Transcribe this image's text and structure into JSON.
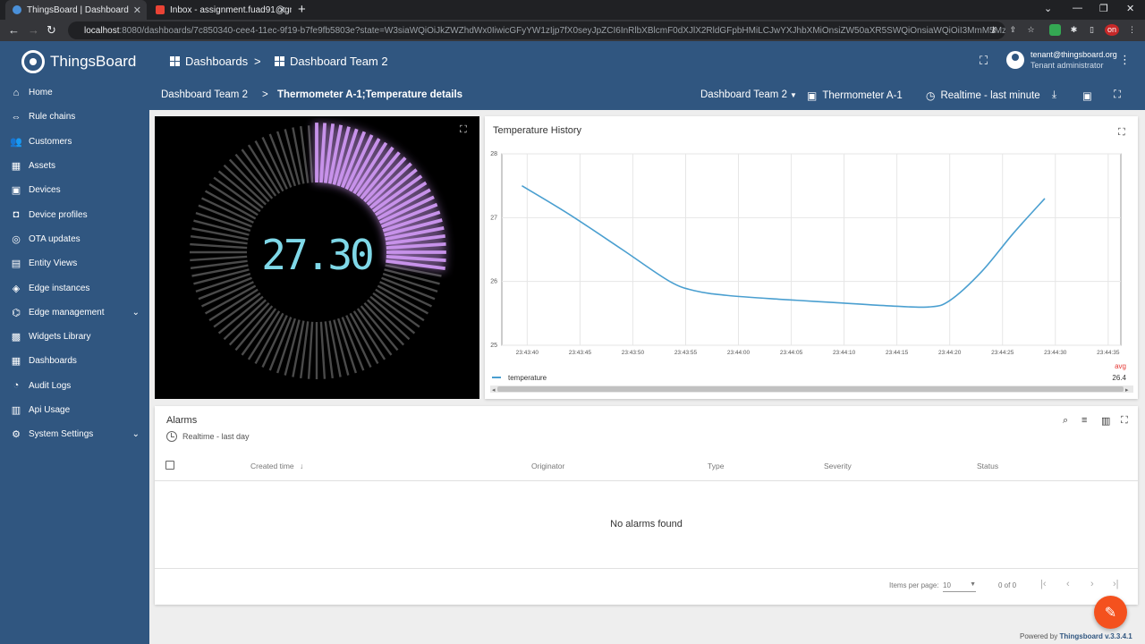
{
  "browser": {
    "tabs": [
      {
        "title": "ThingsBoard | Dashboard",
        "active": true
      },
      {
        "title": "Inbox - assignment.fuad91@gma...",
        "active": false
      }
    ],
    "url_host": "localhost",
    "url_rest": ":8080/dashboards/7c850340-cee4-11ec-9f19-b7fe9fb5803e?state=W3siaWQiOiJkZWZhdWx0IiwicGFyYW1zIjp7fX0seyJpZCI6InRlbXBlcmF0dXJlX2RldGFpbHMiLCJwYXJhbXMiOnsiZW50aXR5SWQiOnsiaWQiOiI3MmM5MzVlMC1lZWUz...",
    "ext_badge": "on"
  },
  "app": {
    "logo": "ThingsBoard",
    "breadcrumb": {
      "parent": "Dashboards",
      "sep": ">",
      "current": "Dashboard Team 2"
    },
    "user": {
      "email": "tenant@thingsboard.org",
      "role": "Tenant administrator"
    }
  },
  "sidebar": {
    "items": [
      {
        "label": "Home",
        "icon": "home-icon",
        "glyph": "⌂",
        "expandable": false
      },
      {
        "label": "Rule chains",
        "icon": "rule-chains-icon",
        "glyph": "⇔",
        "expandable": false
      },
      {
        "label": "Customers",
        "icon": "customers-icon",
        "glyph": "👥",
        "expandable": false
      },
      {
        "label": "Assets",
        "icon": "assets-icon",
        "glyph": "▦",
        "expandable": false
      },
      {
        "label": "Devices",
        "icon": "devices-icon",
        "glyph": "▣",
        "expandable": false
      },
      {
        "label": "Device profiles",
        "icon": "device-profiles-icon",
        "glyph": "◘",
        "expandable": false
      },
      {
        "label": "OTA updates",
        "icon": "ota-updates-icon",
        "glyph": "◎",
        "expandable": false
      },
      {
        "label": "Entity Views",
        "icon": "entity-views-icon",
        "glyph": "▤",
        "expandable": false
      },
      {
        "label": "Edge instances",
        "icon": "edge-instances-icon",
        "glyph": "◈",
        "expandable": false
      },
      {
        "label": "Edge management",
        "icon": "edge-management-icon",
        "glyph": "⌬",
        "expandable": true
      },
      {
        "label": "Widgets Library",
        "icon": "widgets-library-icon",
        "glyph": "▩",
        "expandable": false
      },
      {
        "label": "Dashboards",
        "icon": "dashboards-icon",
        "glyph": "▦",
        "expandable": false
      },
      {
        "label": "Audit Logs",
        "icon": "audit-logs-icon",
        "glyph": "◔",
        "expandable": false
      },
      {
        "label": "Api Usage",
        "icon": "api-usage-icon",
        "glyph": "▥",
        "expandable": false
      },
      {
        "label": "System Settings",
        "icon": "system-settings-icon",
        "glyph": "⚙",
        "expandable": true
      }
    ]
  },
  "dashboard": {
    "crumb_root": "Dashboard Team 2",
    "crumb_sep": ">",
    "crumb_state": "Thermometer A-1;Temperature details",
    "state_select": "Dashboard Team 2",
    "entity": "Thermometer A-1",
    "timewindow": "Realtime - last minute"
  },
  "gauge": {
    "value": 27.3,
    "display": "27.30",
    "min": 0,
    "max": 100,
    "colors": {
      "active": "#c792ea",
      "inactive": "#4a4a4a",
      "text": "#7fd8e8"
    }
  },
  "temperature_chart": {
    "title": "Temperature History",
    "legend_label": "temperature",
    "legend_stat_label": "avg",
    "legend_stat_value": "26.4",
    "color": "#4a9fd0"
  },
  "chart_data": {
    "type": "line",
    "title": "Temperature History",
    "ylim": [
      25,
      28
    ],
    "y_ticks": [
      25,
      26,
      27,
      28
    ],
    "x_ticks": [
      "23:43:40",
      "23:43:45",
      "23:43:50",
      "23:43:55",
      "23:44:00",
      "23:44:05",
      "23:44:10",
      "23:44:15",
      "23:44:20",
      "23:44:25",
      "23:44:30",
      "23:44:35"
    ],
    "x_range_seconds": [
      37.6,
      96.2
    ],
    "series": [
      {
        "name": "temperature",
        "x": [
          39.5,
          44,
          49,
          53.5,
          56,
          59,
          64,
          69,
          74,
          78,
          80,
          83,
          86,
          89
        ],
        "y": [
          27.5,
          27.05,
          26.5,
          26.0,
          25.85,
          25.78,
          25.72,
          25.67,
          25.62,
          25.6,
          25.7,
          26.15,
          26.75,
          27.3
        ]
      }
    ],
    "legend": "bottom-left",
    "grid": true
  },
  "alarms": {
    "title": "Alarms",
    "timewindow": "Realtime - last day",
    "columns": [
      "Created time",
      "Originator",
      "Type",
      "Severity",
      "Status"
    ],
    "empty_text": "No alarms found",
    "items_per_page_label": "Items per page:",
    "items_per_page": "10",
    "range_text": "0 of 0"
  },
  "footer": {
    "powered_prefix": "Powered by",
    "powered_name": "Thingsboard v.3.3.4.1"
  }
}
